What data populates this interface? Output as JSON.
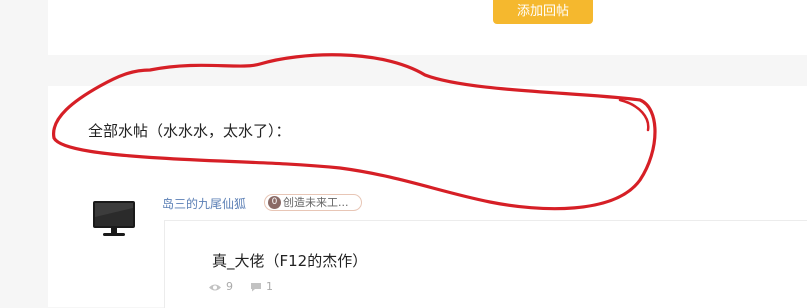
{
  "top": {
    "add_reply_label": "添加回帖"
  },
  "section": {
    "title": "全部水帖（水水水，太水了）："
  },
  "post": {
    "username": "岛三的九尾仙狐",
    "badge_level": "0",
    "badge_text": "创造未来工...",
    "title": "真_大佬（F12的杰作）",
    "views": "9",
    "replies": "1"
  },
  "colors": {
    "accent": "#f5b82e",
    "username": "#5b7fb5",
    "annotation": "#d61f26"
  },
  "icons": [
    "monitor-avatar-icon",
    "eye-icon",
    "comment-icon"
  ]
}
